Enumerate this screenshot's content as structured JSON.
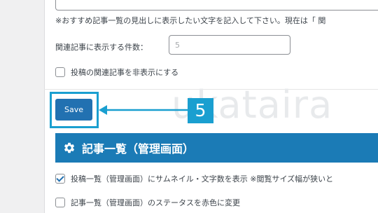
{
  "settings": {
    "hint_text": "※おすすめ記事一覧の見出しに表示したい文字を記入して下さい。現在は「 関",
    "count_label": "関連記事に表示する件数：",
    "count_value": "5",
    "hide_related_label": "投稿の関連記事を非表示にする",
    "hide_related_checked": false
  },
  "save_button": {
    "label": "Save"
  },
  "annotation": {
    "step_number": "5",
    "watermark": "ukataira"
  },
  "admin_list_section": {
    "title": "記事一覧（管理画面）",
    "icon": "gear-icon",
    "options": [
      {
        "label": "投稿一覧（管理画面）にサムネイル・文字数を表示 ※閲覧サイズ幅が狭いと",
        "checked": true
      },
      {
        "label": "記事一覧（管理画面）のステータスを赤色に変更",
        "checked": false
      }
    ]
  },
  "colors": {
    "accent": "#1a9fd0",
    "button": "#2271b1",
    "section_header": "#1b7bb6"
  }
}
